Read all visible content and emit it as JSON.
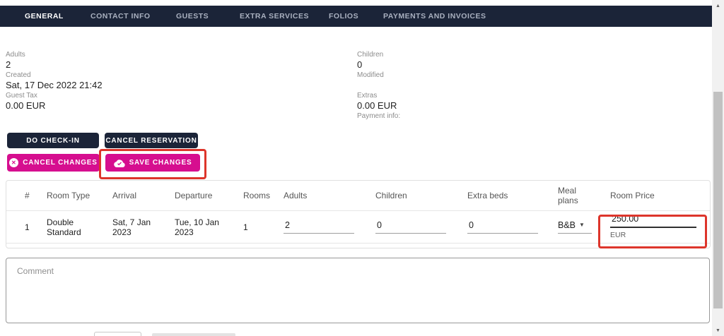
{
  "nav": {
    "tabs": [
      {
        "label": "GENERAL",
        "active": true
      },
      {
        "label": "CONTACT INFO",
        "active": false
      },
      {
        "label": "GUESTS",
        "active": false
      },
      {
        "label": "EXTRA SERVICES",
        "active": false
      },
      {
        "label": "FOLIOS",
        "active": false
      },
      {
        "label": "PAYMENTS AND INVOICES",
        "active": false
      }
    ]
  },
  "info": {
    "left": [
      {
        "label": "Adults",
        "value": "2"
      },
      {
        "label": "Created",
        "value": "Sat, 17 Dec 2022 21:42"
      },
      {
        "label": "Guest Tax",
        "value": "0.00 EUR"
      }
    ],
    "right": [
      {
        "label": "Children",
        "value": "0"
      },
      {
        "label": "Modified",
        "value": ""
      },
      {
        "label": "Extras",
        "value": "0.00 EUR"
      },
      {
        "label": "Payment info:",
        "value": ""
      }
    ]
  },
  "actions": {
    "do_check_in": "DO CHECK-IN",
    "cancel_reservation": "CANCEL RESERVATION",
    "cancel_changes": "CANCEL CHANGES",
    "save_changes": "SAVE CHANGES"
  },
  "rooms_table": {
    "headers": [
      "#",
      "Room Type",
      "Arrival",
      "Departure",
      "Rooms",
      "Adults",
      "Children",
      "Extra beds",
      "Meal plans",
      "Room Price"
    ],
    "rows": [
      {
        "num": "1",
        "room_type": "Double Standard",
        "arrival": "Sat, 7 Jan 2023",
        "departure": "Tue, 10 Jan 2023",
        "rooms": "1",
        "adults": "2",
        "children": "0",
        "extra_beds": "0",
        "meal_plan": "B&B",
        "room_price": "250.00",
        "currency": "EUR"
      }
    ]
  },
  "comment": {
    "placeholder": "Comment"
  },
  "icons": {
    "cancel_x": "✕",
    "meal_caret": "▼",
    "scroll_up": "▲",
    "scroll_down": "▼"
  },
  "colors": {
    "navy": "#1b2438",
    "magenta": "#d60e8f",
    "annotation_red": "#dd352b"
  }
}
